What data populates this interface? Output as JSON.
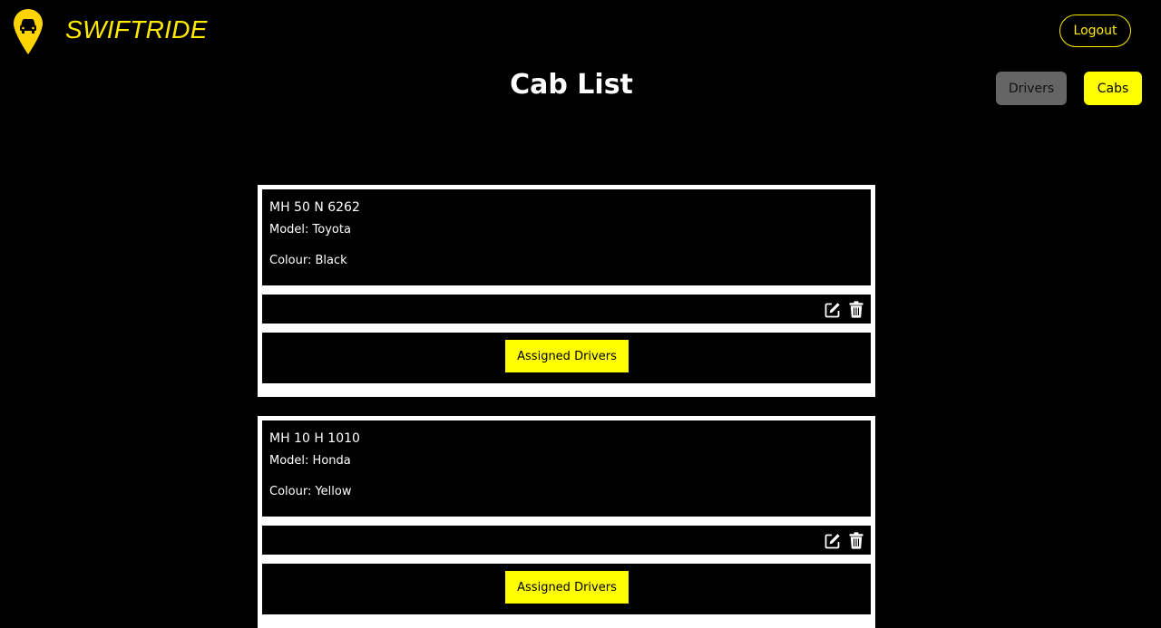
{
  "header": {
    "brand": "SWIFTRIDE",
    "logout_label": "Logout"
  },
  "page": {
    "title": "Cab List"
  },
  "nav": {
    "drivers_label": "Drivers",
    "cabs_label": "Cabs"
  },
  "colors": {
    "accent": "#ffff00",
    "brand_text": "#ffea00",
    "background": "#000000",
    "inactive_nav": "#656565"
  },
  "cabs": [
    {
      "registration": "MH 50 N 6262",
      "model": "Model: Toyota",
      "colour": "Colour: Black",
      "assign_label": "Assigned Drivers"
    },
    {
      "registration": "MH 10 H 1010",
      "model": "Model: Honda",
      "colour": "Colour: Yellow",
      "assign_label": "Assigned Drivers"
    }
  ],
  "icons": {
    "logo": "map-pin-car-icon",
    "edit": "edit-icon",
    "delete": "trash-icon"
  }
}
